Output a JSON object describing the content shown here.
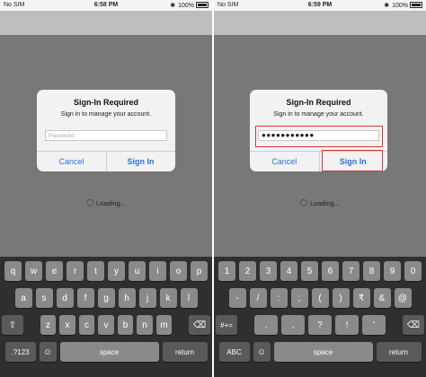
{
  "left": {
    "status": {
      "carrier": "No SIM",
      "time": "6:58 PM",
      "battery": "100%"
    },
    "dialog": {
      "title": "Sign-In Required",
      "message": "Sign in to manage your account.",
      "password_placeholder": "Password",
      "cancel": "Cancel",
      "sign_in": "Sign In"
    },
    "loading": "Loading...",
    "keyboard": {
      "row1": [
        "q",
        "w",
        "e",
        "r",
        "t",
        "y",
        "u",
        "i",
        "o",
        "p"
      ],
      "row2": [
        "a",
        "s",
        "d",
        "f",
        "g",
        "h",
        "j",
        "k",
        "l"
      ],
      "row3": [
        "z",
        "x",
        "c",
        "v",
        "b",
        "n",
        "m"
      ],
      "mode_key": ".?123",
      "space": "space",
      "return": "return"
    }
  },
  "right": {
    "status": {
      "carrier": "No SIM",
      "time": "6:59 PM",
      "battery": "100%"
    },
    "dialog": {
      "title": "Sign-In Required",
      "message": "Sign in to manage your account.",
      "password_value": "●●●●●●●●●●●",
      "cancel": "Cancel",
      "sign_in": "Sign In"
    },
    "loading": "Loading...",
    "keyboard": {
      "row1": [
        "1",
        "2",
        "3",
        "4",
        "5",
        "6",
        "7",
        "8",
        "9",
        "0"
      ],
      "row2": [
        "-",
        "/",
        ":",
        ";",
        "(",
        ")",
        "₹",
        "&",
        "@"
      ],
      "row3": [
        ".",
        ",",
        "?",
        "!",
        "'"
      ],
      "shift_key": "#+=",
      "mode_key": "ABC",
      "space": "space",
      "return": "return"
    }
  },
  "colors": {
    "accent": "#2f73d6",
    "highlight": "#d23a3a"
  }
}
